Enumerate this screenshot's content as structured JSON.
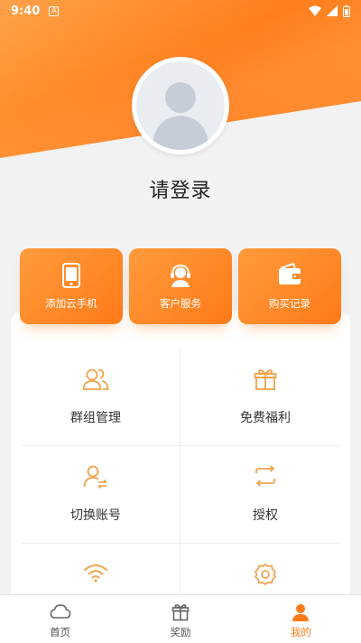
{
  "status_bar": {
    "time": "9:40",
    "sim_label": "A"
  },
  "profile": {
    "login_prompt": "请登录"
  },
  "quick_actions": [
    {
      "label": "添加云手机",
      "icon": "phone-icon"
    },
    {
      "label": "客户服务",
      "icon": "headset-icon"
    },
    {
      "label": "购买记录",
      "icon": "wallet-icon"
    }
  ],
  "menu": [
    {
      "label": "群组管理",
      "icon": "group-icon"
    },
    {
      "label": "免费福利",
      "icon": "gift-icon"
    },
    {
      "label": "切换账号",
      "icon": "switch-account-icon"
    },
    {
      "label": "授权",
      "icon": "authorize-icon"
    },
    {
      "label": "",
      "icon": "wifi-icon"
    },
    {
      "label": "",
      "icon": "settings-icon"
    }
  ],
  "tabbar": [
    {
      "label": "首页",
      "icon": "cloud-icon"
    },
    {
      "label": "奖励",
      "icon": "gift-icon"
    },
    {
      "label": "我的",
      "icon": "user-icon"
    }
  ],
  "colors": {
    "accent": "#ff7a18",
    "accent_light": "#ff9b3c",
    "icon_orange": "#f0a24b"
  }
}
